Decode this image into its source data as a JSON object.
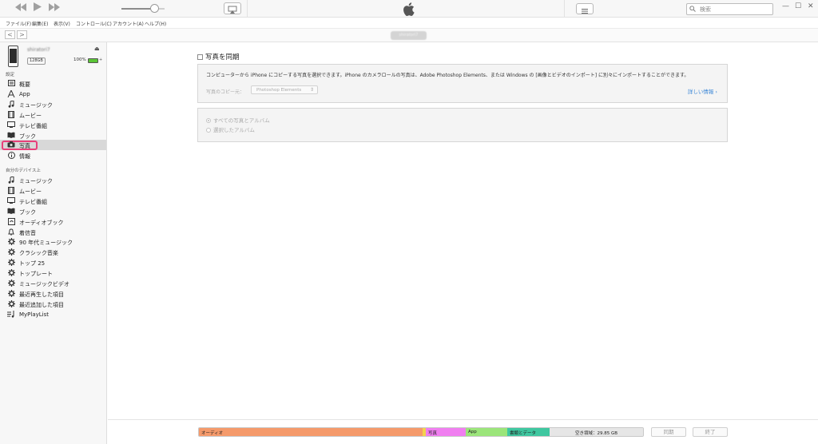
{
  "toolbar": {
    "prev_icon": "rewind-icon",
    "play_icon": "play-icon",
    "next_icon": "fast-forward-icon",
    "volume_level": 0.78,
    "search_placeholder": "検索",
    "window_min": "—",
    "window_max": "☐",
    "window_close": "✕"
  },
  "menu": [
    "ファイル(F)",
    "編集(E)",
    "表示(V)",
    "コントロール(C)",
    "アカウント(A)",
    "ヘルプ(H)"
  ],
  "nav": {
    "back": "<",
    "forward": ">",
    "device_title": "shiratori7"
  },
  "device": {
    "name": "shiratori7",
    "capacity": "128GB",
    "battery_percent": "100%",
    "battery_level": 1.0
  },
  "sidebar": {
    "settings_header": "設定",
    "settings_items": [
      {
        "label": "概要",
        "icon": "summary-icon"
      },
      {
        "label": "App",
        "icon": "app-icon"
      },
      {
        "label": "ミュージック",
        "icon": "music-icon"
      },
      {
        "label": "ムービー",
        "icon": "movie-icon"
      },
      {
        "label": "テレビ番組",
        "icon": "tv-icon"
      },
      {
        "label": "ブック",
        "icon": "book-icon"
      },
      {
        "label": "写真",
        "icon": "camera-icon",
        "active": true
      },
      {
        "label": "情報",
        "icon": "info-icon"
      }
    ],
    "device_header": "自分のデバイス上",
    "device_items": [
      {
        "label": "ミュージック",
        "icon": "music-icon"
      },
      {
        "label": "ムービー",
        "icon": "movie-icon"
      },
      {
        "label": "テレビ番組",
        "icon": "tv-icon"
      },
      {
        "label": "ブック",
        "icon": "book-icon"
      },
      {
        "label": "オーディオブック",
        "icon": "audiobook-icon"
      },
      {
        "label": "着信音",
        "icon": "bell-icon"
      },
      {
        "label": "90 年代ミュージック",
        "icon": "gear-icon"
      },
      {
        "label": "クラシック音楽",
        "icon": "gear-icon"
      },
      {
        "label": "トップ 25",
        "icon": "gear-icon"
      },
      {
        "label": "トップレート",
        "icon": "gear-icon"
      },
      {
        "label": "ミュージックビデオ",
        "icon": "gear-icon"
      },
      {
        "label": "最近再生した項目",
        "icon": "gear-icon"
      },
      {
        "label": "最近追加した項目",
        "icon": "gear-icon"
      },
      {
        "label": "MyPlayList",
        "icon": "playlist-icon"
      }
    ]
  },
  "photos": {
    "sync_label": "写真を同期",
    "description": "コンピューターから iPhone にコピーする写真を選択できます。iPhone のカメラロールの写真は、Adobe Photoshop Elements、または Windows の [画像とビデオのインポート] に別々にインポートすることができます。",
    "copy_from_label": "写真のコピー元：",
    "copy_from_value": "Photoshop Elements",
    "more_info": "詳しい情報",
    "option_all": "すべての写真とアルバム",
    "option_selected": "選択したアルバム"
  },
  "capacity_bar": {
    "segments": [
      {
        "label": "オーディオ",
        "color": "#f59a6b"
      },
      {
        "label": "",
        "color": "#f2d34d"
      },
      {
        "label": "写真",
        "color": "#f07ef0"
      },
      {
        "label": "App",
        "color": "#9be57a"
      },
      {
        "label": "書類とデータ",
        "color": "#3fc7a0"
      },
      {
        "label": "空き領域：29.85 GB",
        "color": "#e6e6e6"
      }
    ]
  },
  "buttons": {
    "sync": "同期",
    "done": "終了"
  }
}
